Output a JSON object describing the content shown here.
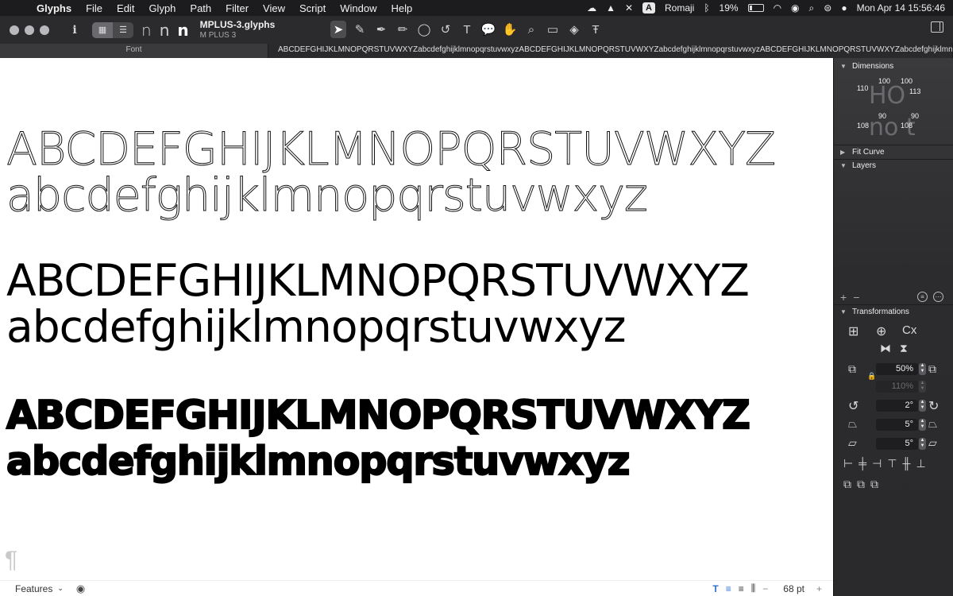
{
  "menubar": {
    "app_name": "Glyphs",
    "items": [
      "File",
      "Edit",
      "Glyph",
      "Path",
      "Filter",
      "View",
      "Script",
      "Window",
      "Help"
    ],
    "status": {
      "input_source_badge": "A",
      "input_source_name": "Romaji",
      "battery_percent": "19%",
      "datetime": "Mon Apr 14  15:56:46"
    }
  },
  "toolbar": {
    "doc_title": "MPLUS-3.glyphs",
    "doc_subtitle": "M PLUS 3",
    "master_labels": [
      "n",
      "n",
      "n"
    ],
    "info_label": "i"
  },
  "tabs": {
    "font_tab": "Font",
    "text_tab": "ABCDEFGHIJKLMNOPQRSTUVWXYZabcdefghijklmnopqrstuvwxyzABCDEFGHIJKLMNOPQRSTUVWXYZabcdefghijklmnopqrstuvwxyzABCDEFGHIJKLMNOPQRSTUVWXYZabcdefghijklmnopqrstuvwxyzABCDEFGHIJKLMNOPQRSTUVWXYZabcdefghijklmnopqrstuvwxyz"
  },
  "canvas": {
    "upper": "ABCDEFGHIJKLMNOPQRSTUVWXYZ",
    "lower": "abcdefghijklmnopqrstuvwxyz",
    "pilcrow": "¶"
  },
  "bottombar": {
    "features_label": "Features",
    "font_size": "68 pt",
    "minus": "−",
    "plus": "+"
  },
  "inspector": {
    "dimensions": {
      "title": "Dimensions",
      "upper_ghost": "HO",
      "lower_ghost": "no t",
      "values": {
        "h_left": "110",
        "h_right": "100",
        "o_left": "100",
        "o_right": "113",
        "n_left": "108",
        "n_right": "90",
        "o2_left": "108",
        "o2_right": "90"
      }
    },
    "fit_curve": "Fit Curve",
    "layers": "Layers",
    "transformations": {
      "title": "Transformations",
      "scale_value": "50%",
      "scale_value_2": "110%",
      "rotate_value": "2°",
      "slant_value": "5°",
      "slant_value_2": "5°"
    }
  }
}
